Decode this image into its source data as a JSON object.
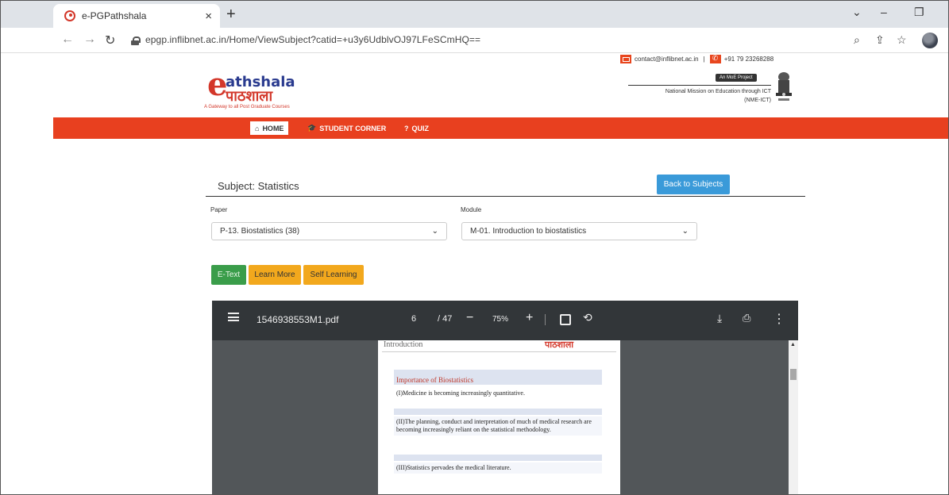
{
  "browser": {
    "tab_title": "e-PGPathshala",
    "tab_close": "×",
    "new_tab": "+",
    "url": "epgp.inflibnet.ac.in/Home/ViewSubject?catid=+u3y6UdblvOJ97LFeSCmHQ=="
  },
  "header": {
    "email": "contact@inflibnet.ac.in",
    "separator": "|",
    "phone": "+91 79 23268288",
    "logo_e": "e",
    "logo_text": "athshala",
    "logo_hindi": "पाठशाला",
    "logo_tagline": "A Gateway to all Post Graduate Courses",
    "moe_badge": "An MoE Project",
    "nme_line1": "National Mission on Education through ICT",
    "nme_line2": "(NME-ICT)"
  },
  "nav": {
    "home": "HOME",
    "student_corner": "STUDENT CORNER",
    "quiz": "QUIZ"
  },
  "content": {
    "subject_title": "Subject: Statistics",
    "back_button": "Back to Subjects",
    "paper_label": "Paper",
    "paper_value": "P-13. Biostatistics (38)",
    "module_label": "Module",
    "module_value": "M-01. Introduction to biostatistics",
    "etext_button": "E-Text",
    "learn_more_button": "Learn More",
    "self_learning_button": "Self Learning"
  },
  "pdf": {
    "filename": "1546938553M1.pdf",
    "page_current": "6",
    "page_total": "/ 47",
    "zoom": "75%",
    "page_header": "Introduction",
    "page_logo": "पाठशाला",
    "section_title": "Importance of Biostatistics",
    "point1": "(I)Medicine is becoming increasingly quantitative.",
    "point2": "(II)The planning, conduct and interpretation of much of medical research are becoming increasingly reliant on the statistical methodology.",
    "point3": "(III)Statistics pervades the medical literature."
  },
  "colors": {
    "nav_red": "#e8401f",
    "back_blue": "#3a9ad9",
    "etext_green": "#3a9d4a",
    "orange": "#f2a81d"
  }
}
